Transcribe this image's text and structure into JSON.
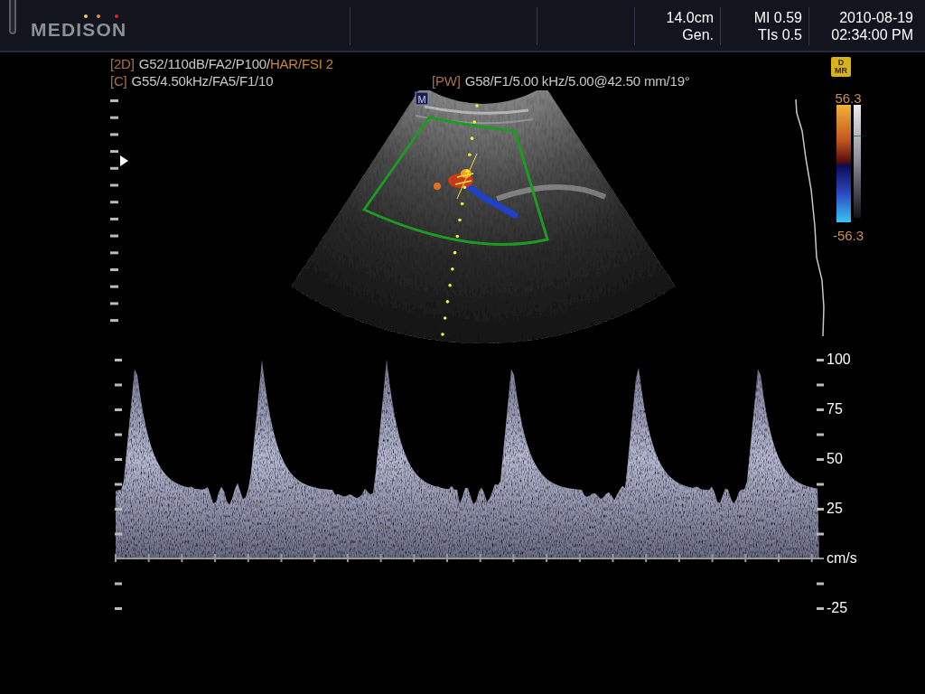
{
  "header": {
    "logo": "MEDISON",
    "cells": [
      {},
      {},
      {
        "lines": [
          "14.0cm",
          "Gen."
        ]
      },
      {
        "lines": [
          "MI 0.59",
          "TIs 0.5"
        ]
      },
      {
        "lines": [
          "2010-08-19",
          "02:34:00 PM"
        ]
      }
    ]
  },
  "parameters": [
    {
      "mode": "[2D]",
      "settings": "G52/110dB/FA2/P100/",
      "extra": "HAR/FSI 2"
    },
    {
      "mode": "[C]",
      "settings": "G55/4.50kHz/FA5/F1/10"
    }
  ],
  "pw_parameters": {
    "mode": "[PW]",
    "settings": "G58/F1/5.00 kHz/5.00@42.50 mm/19°"
  },
  "dmr_badge": {
    "top": "D",
    "bottom": "MR"
  },
  "sector": {
    "marker": "M"
  },
  "color_scale": {
    "max": "56.3",
    "min": "-56.3"
  },
  "spectrum": {
    "scale": [
      "100",
      "75",
      "50",
      "25",
      "cm/s",
      "-25"
    ]
  }
}
